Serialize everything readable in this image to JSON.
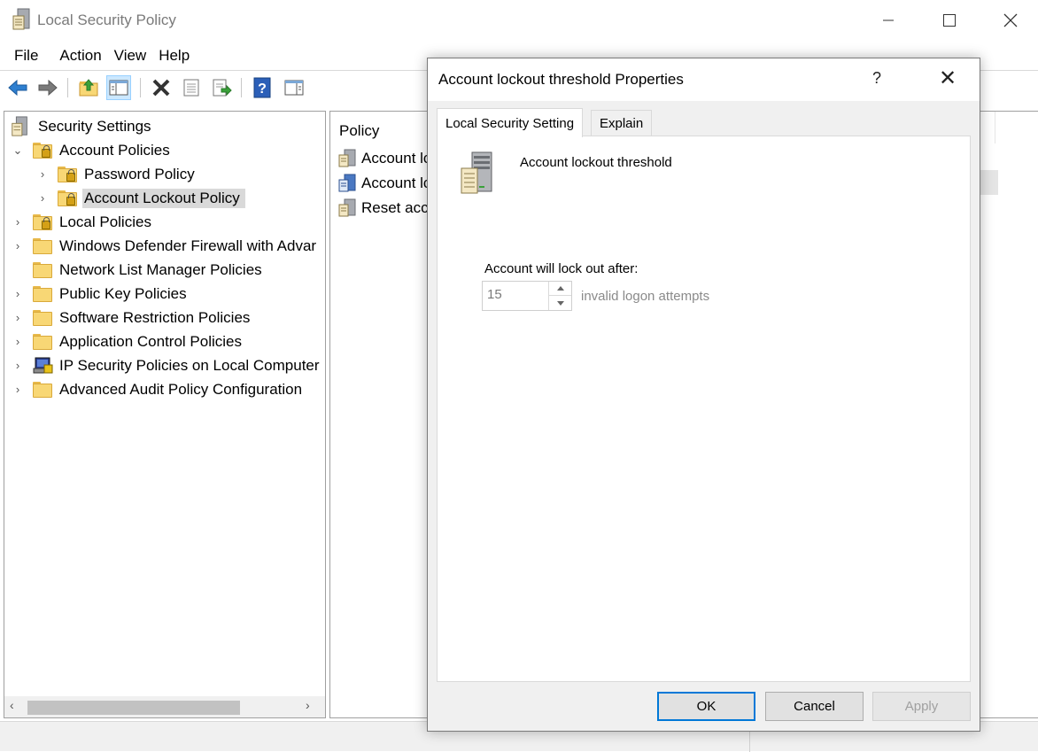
{
  "window": {
    "title": "Local Security Policy"
  },
  "menu": [
    "File",
    "Action",
    "View",
    "Help"
  ],
  "toolbar": {
    "icons": [
      "back-arrow-icon",
      "forward-arrow-icon",
      "up-folder-icon",
      "show-hide-tree-icon",
      "delete-icon",
      "properties-icon",
      "export-list-icon",
      "help-icon",
      "show-action-pane-icon"
    ]
  },
  "tree": {
    "root": "Security Settings",
    "items": [
      {
        "label": "Account Policies",
        "level": 1,
        "expanded": true,
        "icon": "folder-lock-icon"
      },
      {
        "label": "Password Policy",
        "level": 2,
        "icon": "folder-lock-icon"
      },
      {
        "label": "Account Lockout Policy",
        "level": 2,
        "icon": "folder-lock-icon",
        "selected": true
      },
      {
        "label": "Local Policies",
        "level": 1,
        "icon": "folder-lock-icon"
      },
      {
        "label": "Windows Defender Firewall with Advar",
        "level": 1,
        "icon": "folder-icon"
      },
      {
        "label": "Network List Manager Policies",
        "level": 1,
        "icon": "folder-icon",
        "no_expander": true
      },
      {
        "label": "Public Key Policies",
        "level": 1,
        "icon": "folder-icon"
      },
      {
        "label": "Software Restriction Policies",
        "level": 1,
        "icon": "folder-icon"
      },
      {
        "label": "Application Control Policies",
        "level": 1,
        "icon": "folder-icon"
      },
      {
        "label": "IP Security Policies on Local Computer",
        "level": 1,
        "icon": "ip-security-icon"
      },
      {
        "label": "Advanced Audit Policy Configuration",
        "level": 1,
        "icon": "folder-icon"
      }
    ]
  },
  "policy_list": {
    "header": "Policy",
    "rows": [
      "Account lc",
      "Account lc",
      "Reset acco"
    ]
  },
  "dialog": {
    "title": "Account lockout threshold Properties",
    "help": "?",
    "close": "✕",
    "tabs": [
      "Local Security Setting",
      "Explain"
    ],
    "policy_name": "Account lockout threshold",
    "lockout_label": "Account will lock out after:",
    "threshold_value": "15",
    "attempts_label": "invalid logon attempts",
    "buttons": {
      "ok": "OK",
      "cancel": "Cancel",
      "apply": "Apply"
    }
  },
  "colors": {
    "accent": "#0078d7",
    "selection": "#cce8ff",
    "folder": "#f8d775"
  }
}
